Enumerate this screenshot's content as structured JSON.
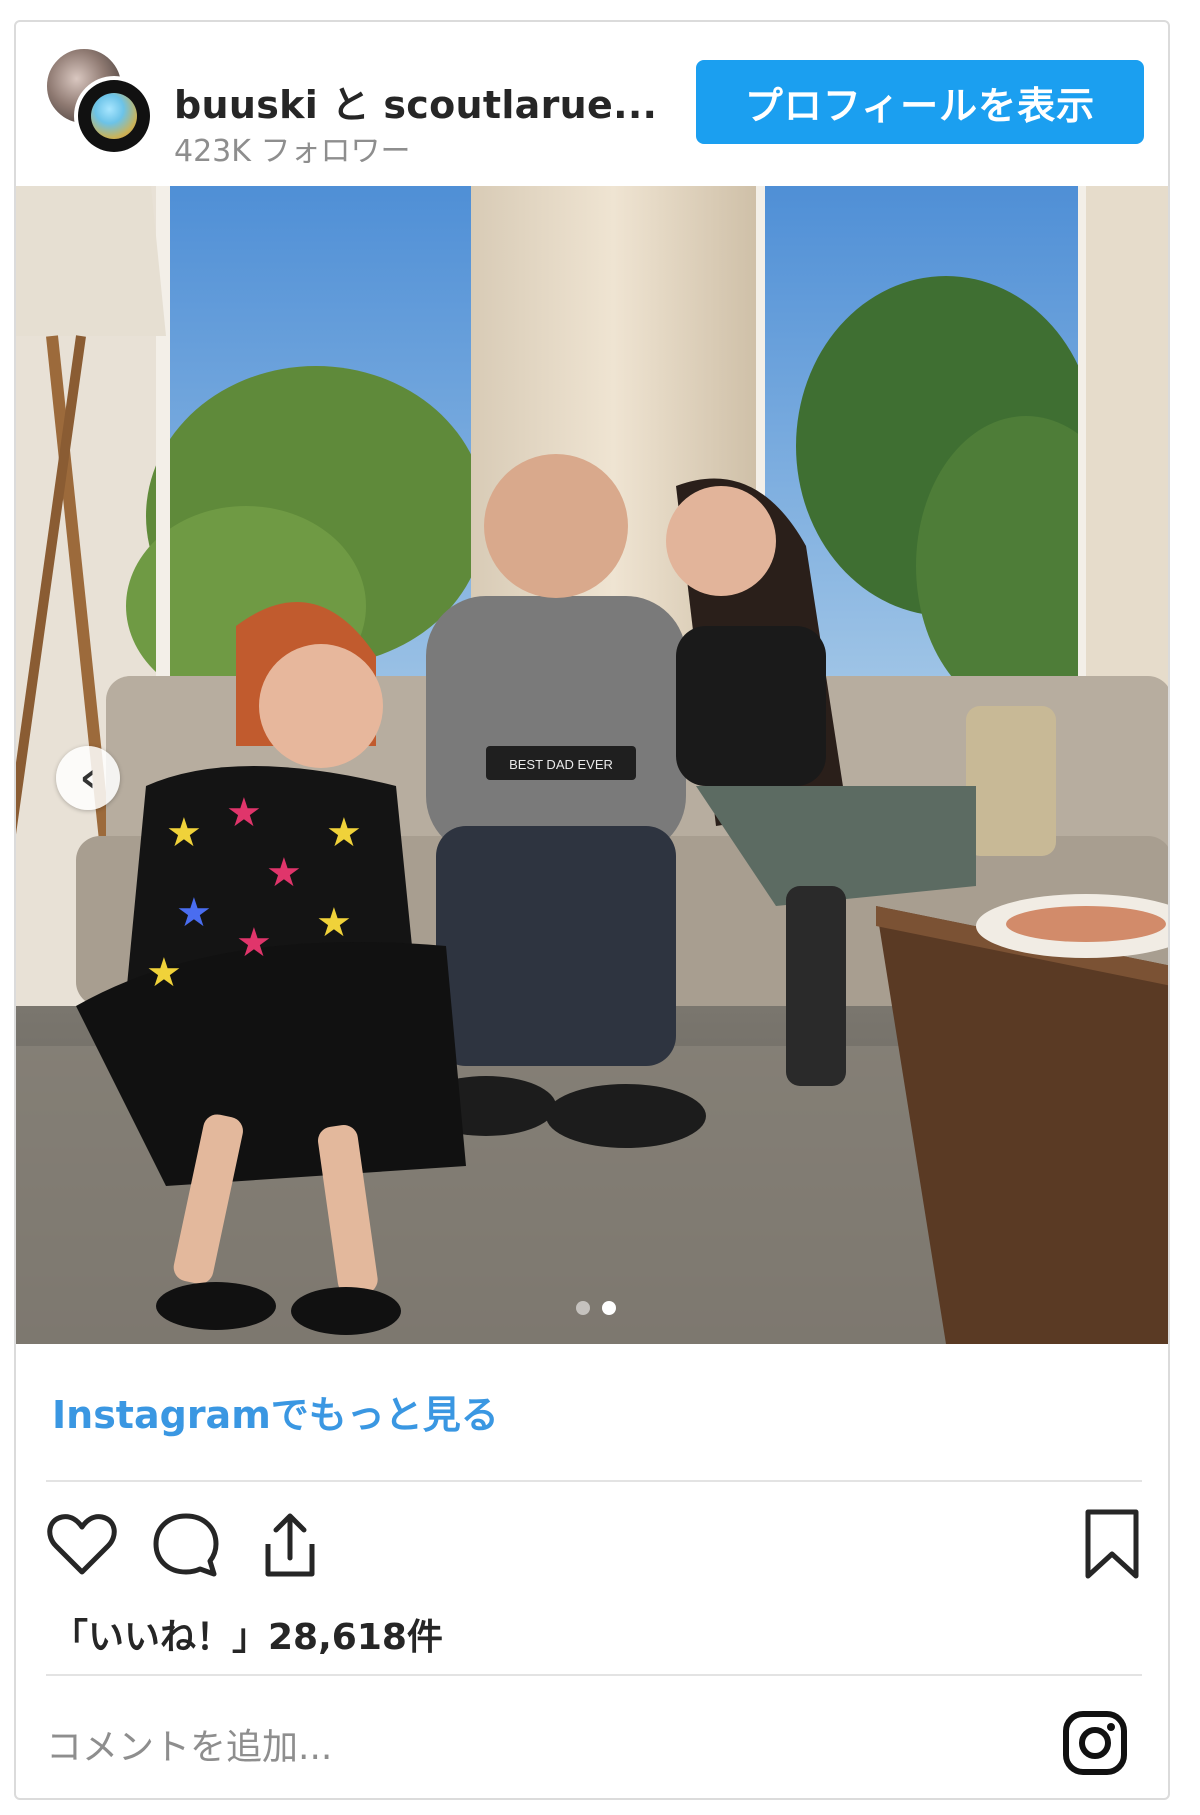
{
  "header": {
    "username": "buuski と scoutlarue...",
    "followers": "423K フォロワー",
    "profile_button": "プロフィールを表示",
    "avatar_icons": [
      "avatar-buuski",
      "avatar-scoutlarue"
    ]
  },
  "post": {
    "photo_caption_sign": "BEST DAD EVER",
    "carousel": {
      "total": 2,
      "active": 2,
      "prev_icon": "chevron-left-icon"
    }
  },
  "more_link": "Instagramでもっと見る",
  "actions": {
    "icons": [
      "heart-icon",
      "comment-icon",
      "share-icon",
      "bookmark-icon"
    ]
  },
  "likes_text": "「いいね！」28,618件",
  "comment_placeholder": "コメントを追加...",
  "colors": {
    "accent": "#1b9ff0",
    "link": "#3a97e2",
    "text": "#262626",
    "muted": "#8e8e8e",
    "border": "#dbdbdb"
  }
}
